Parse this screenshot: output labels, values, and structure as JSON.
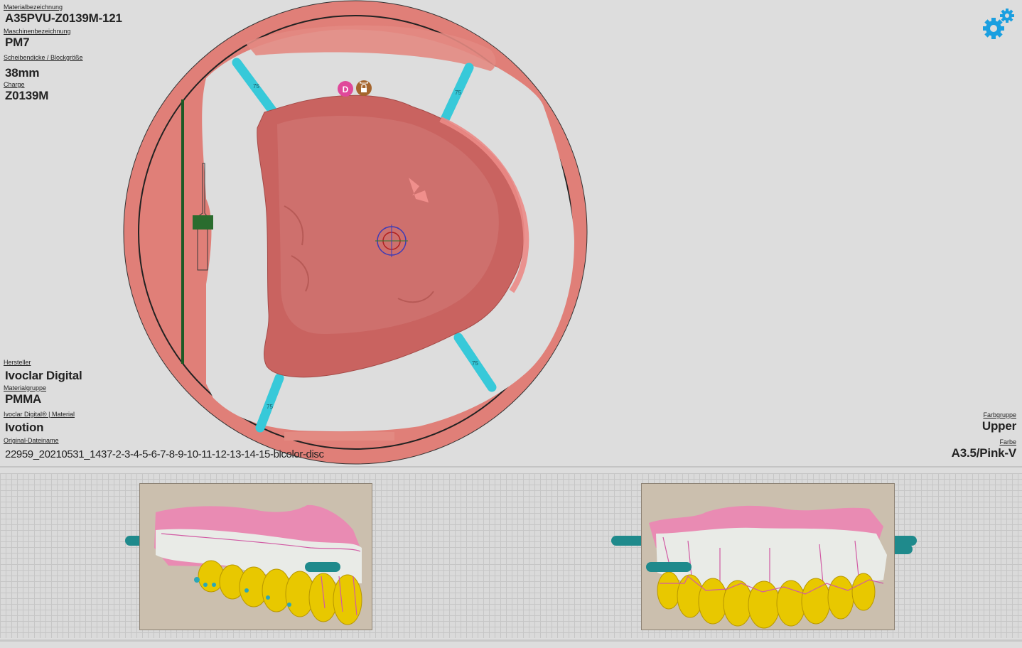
{
  "material": {
    "materialbezeichnung": {
      "label": "Materialbezeichnung",
      "value": "A35PVU-Z0139M-121"
    },
    "maschinenbezeichnung": {
      "label": "Maschinenbezeichnung",
      "value": "PM7"
    },
    "scheibendicke": {
      "label": "Scheibendicke / Blockgröße",
      "value": "38mm"
    },
    "charge": {
      "label": "Charge",
      "value": "Z0139M"
    },
    "hersteller": {
      "label": "Hersteller",
      "value": "Ivoclar Digital"
    },
    "materialgruppe": {
      "label": "Materialgruppe",
      "value": "PMMA"
    },
    "ivoclar_material": {
      "label": "Ivoclar Digital®  |  Material",
      "value": "Ivotion"
    },
    "dateiname": {
      "label": "Original-Dateiname",
      "value": "22959_20210531_1437-2-3-4-5-6-7-8-9-10-11-12-13-14-15-bicolor-disc"
    },
    "farbgruppe": {
      "label": "Farbgruppe",
      "value": "Upper"
    },
    "farbe": {
      "label": "Farbe",
      "value": "A3.5/Pink-V"
    }
  },
  "disc": {
    "badge_d": "D",
    "connector_labels": [
      "75",
      "75",
      "75",
      "75"
    ]
  },
  "icons": {
    "settings": "gears-icon",
    "lock": "lock-move-icon",
    "crosshair": "crosshair-icon"
  },
  "colors": {
    "disc_fill": "#e07f78",
    "model": "#c96360",
    "connector": "#37c9d9",
    "gear": "#1a9fe0",
    "badge_d": "#e0489a",
    "lock_badge": "#a5652d",
    "teeth": "#e8c800",
    "gingiva": "#e27fa8"
  }
}
